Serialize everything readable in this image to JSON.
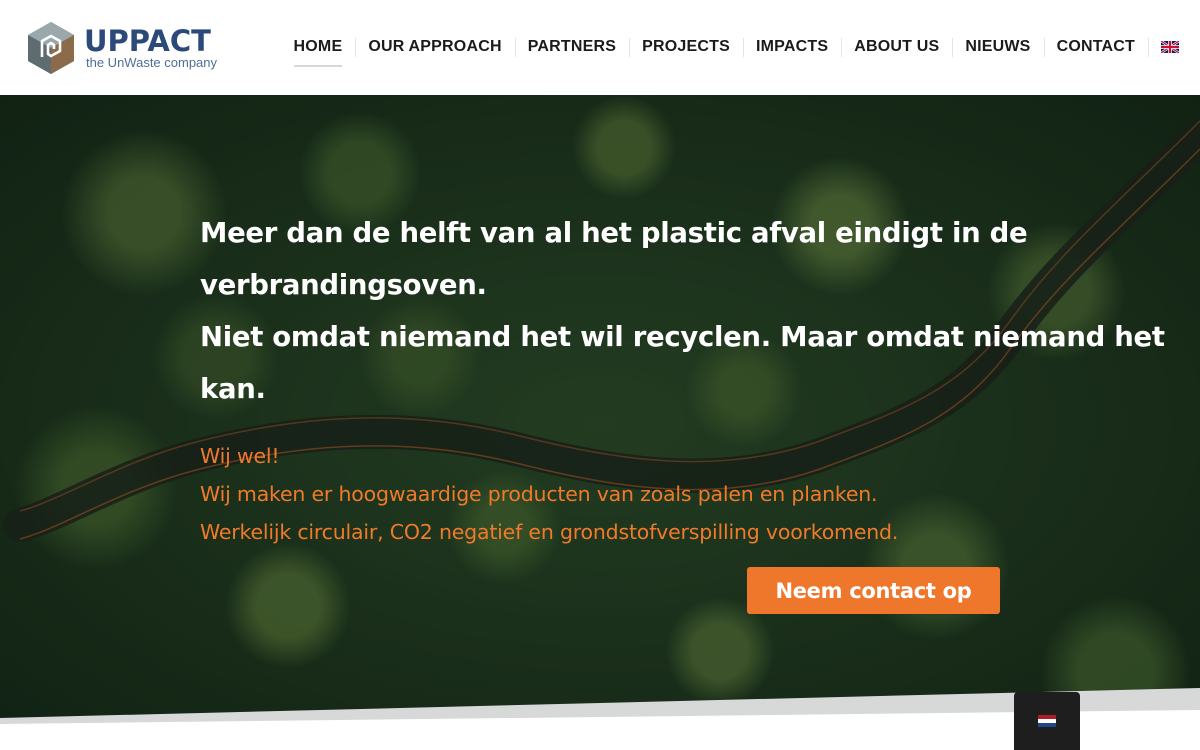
{
  "brand": {
    "name": "UPPACT",
    "tagline": "the UnWaste company"
  },
  "nav": {
    "items": [
      {
        "label": "HOME",
        "active": true
      },
      {
        "label": "OUR APPROACH"
      },
      {
        "label": "PARTNERS"
      },
      {
        "label": "PROJECTS"
      },
      {
        "label": "IMPACTS"
      },
      {
        "label": "ABOUT US"
      },
      {
        "label": "NIEUWS"
      },
      {
        "label": "CONTACT"
      }
    ],
    "language_icon": "uk-flag-icon"
  },
  "hero": {
    "heading_lines": [
      "Meer dan de helft van al het plastic afval eindigt in de",
      "verbrandingsoven.",
      "Niet omdat niemand het wil recyclen. Maar omdat niemand het",
      "kan."
    ],
    "sub_lines": [
      "Wij wel!",
      "Wij maken er hoogwaardige producten van zoals palen en planken.",
      "Werkelijk circulair, CO2 negatief en grondstofverspilling voorkomend."
    ],
    "cta_label": "Neem contact op"
  },
  "language_switcher": {
    "icon": "nl-flag-icon"
  },
  "colors": {
    "brand_blue": "#2b4a7a",
    "accent_orange": "#ef772b",
    "forest_dark": "#1f3620"
  }
}
